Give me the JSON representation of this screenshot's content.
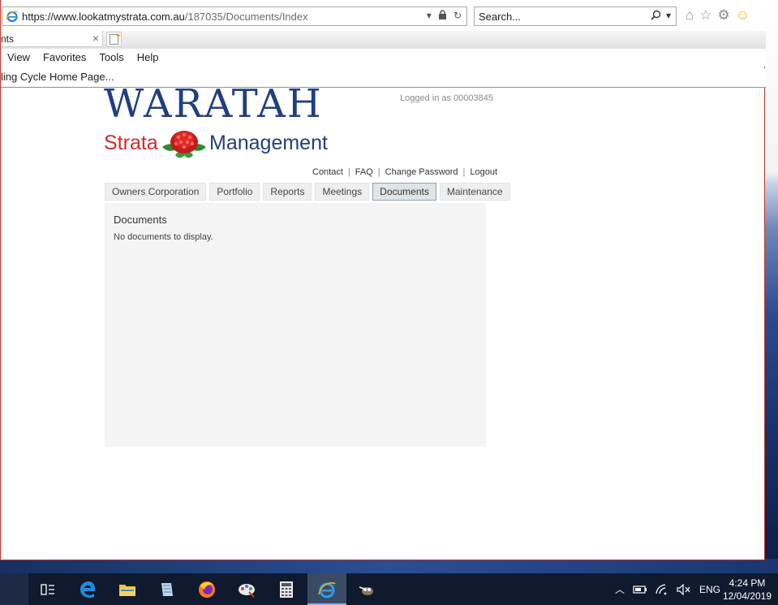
{
  "browser": {
    "url_host": "https://www.lookatmystrata.com.au",
    "url_path": "/187035/Documents/Index",
    "search_placeholder": "Search...",
    "tab_label": "nts",
    "menu": [
      "View",
      "Favorites",
      "Tools",
      "Help"
    ],
    "favorite_item": "ling Cycle Home Page..."
  },
  "site": {
    "logo_main": "WARATAH",
    "logo_strata": "Strata",
    "logo_management": "Management",
    "logged_in": "Logged in as 00003845",
    "links": [
      "Contact",
      "FAQ",
      "Change Password",
      "Logout"
    ],
    "nav": [
      "Owners Corporation",
      "Portfolio",
      "Reports",
      "Meetings",
      "Documents",
      "Maintenance"
    ],
    "active_nav": "Documents"
  },
  "panel": {
    "title": "Documents",
    "message": "No documents to display."
  },
  "taskbar": {
    "language": "ENG",
    "time": "4:24 PM",
    "date": "12/04/2019"
  },
  "colors": {
    "logo_blue": "#1f3f7f",
    "logo_red": "#d42a2a",
    "panel_bg": "#f3f4f3",
    "active_tab_border": "#8fa1ad"
  }
}
